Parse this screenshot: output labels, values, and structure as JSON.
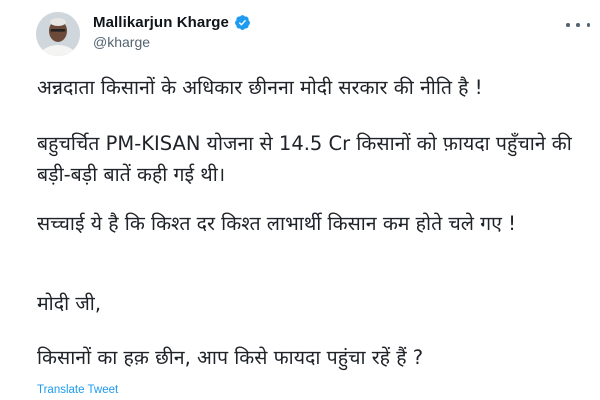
{
  "author": {
    "display_name": "Mallikarjun Kharge",
    "handle": "@kharge",
    "verified": true,
    "avatar_icon": "profile-photo",
    "verified_icon": "verified-badge-icon"
  },
  "tweet": {
    "paragraphs": [
      "अन्नदाता किसानों के अधिकार छीनना मोदी सरकार की नीति है !",
      "बहुचर्चित PM-KISAN योजना से 14.5 Cr किसानों को फ़ायदा पहुँचाने की बड़ी-बड़ी बातें कही गई थी।",
      "सच्चाई ये है कि किश्त दर किश्त लाभार्थी किसान कम होते चले गए !",
      "मोदी जी,",
      "किसानों का हक़ छीन, आप किसे फायदा पहुंचा रहें हैं ?"
    ],
    "translate_label": "Translate Tweet"
  },
  "colors": {
    "text": "#0f1419",
    "secondary": "#536471",
    "link": "#1d9bf0",
    "verified": "#1d9bf0"
  }
}
